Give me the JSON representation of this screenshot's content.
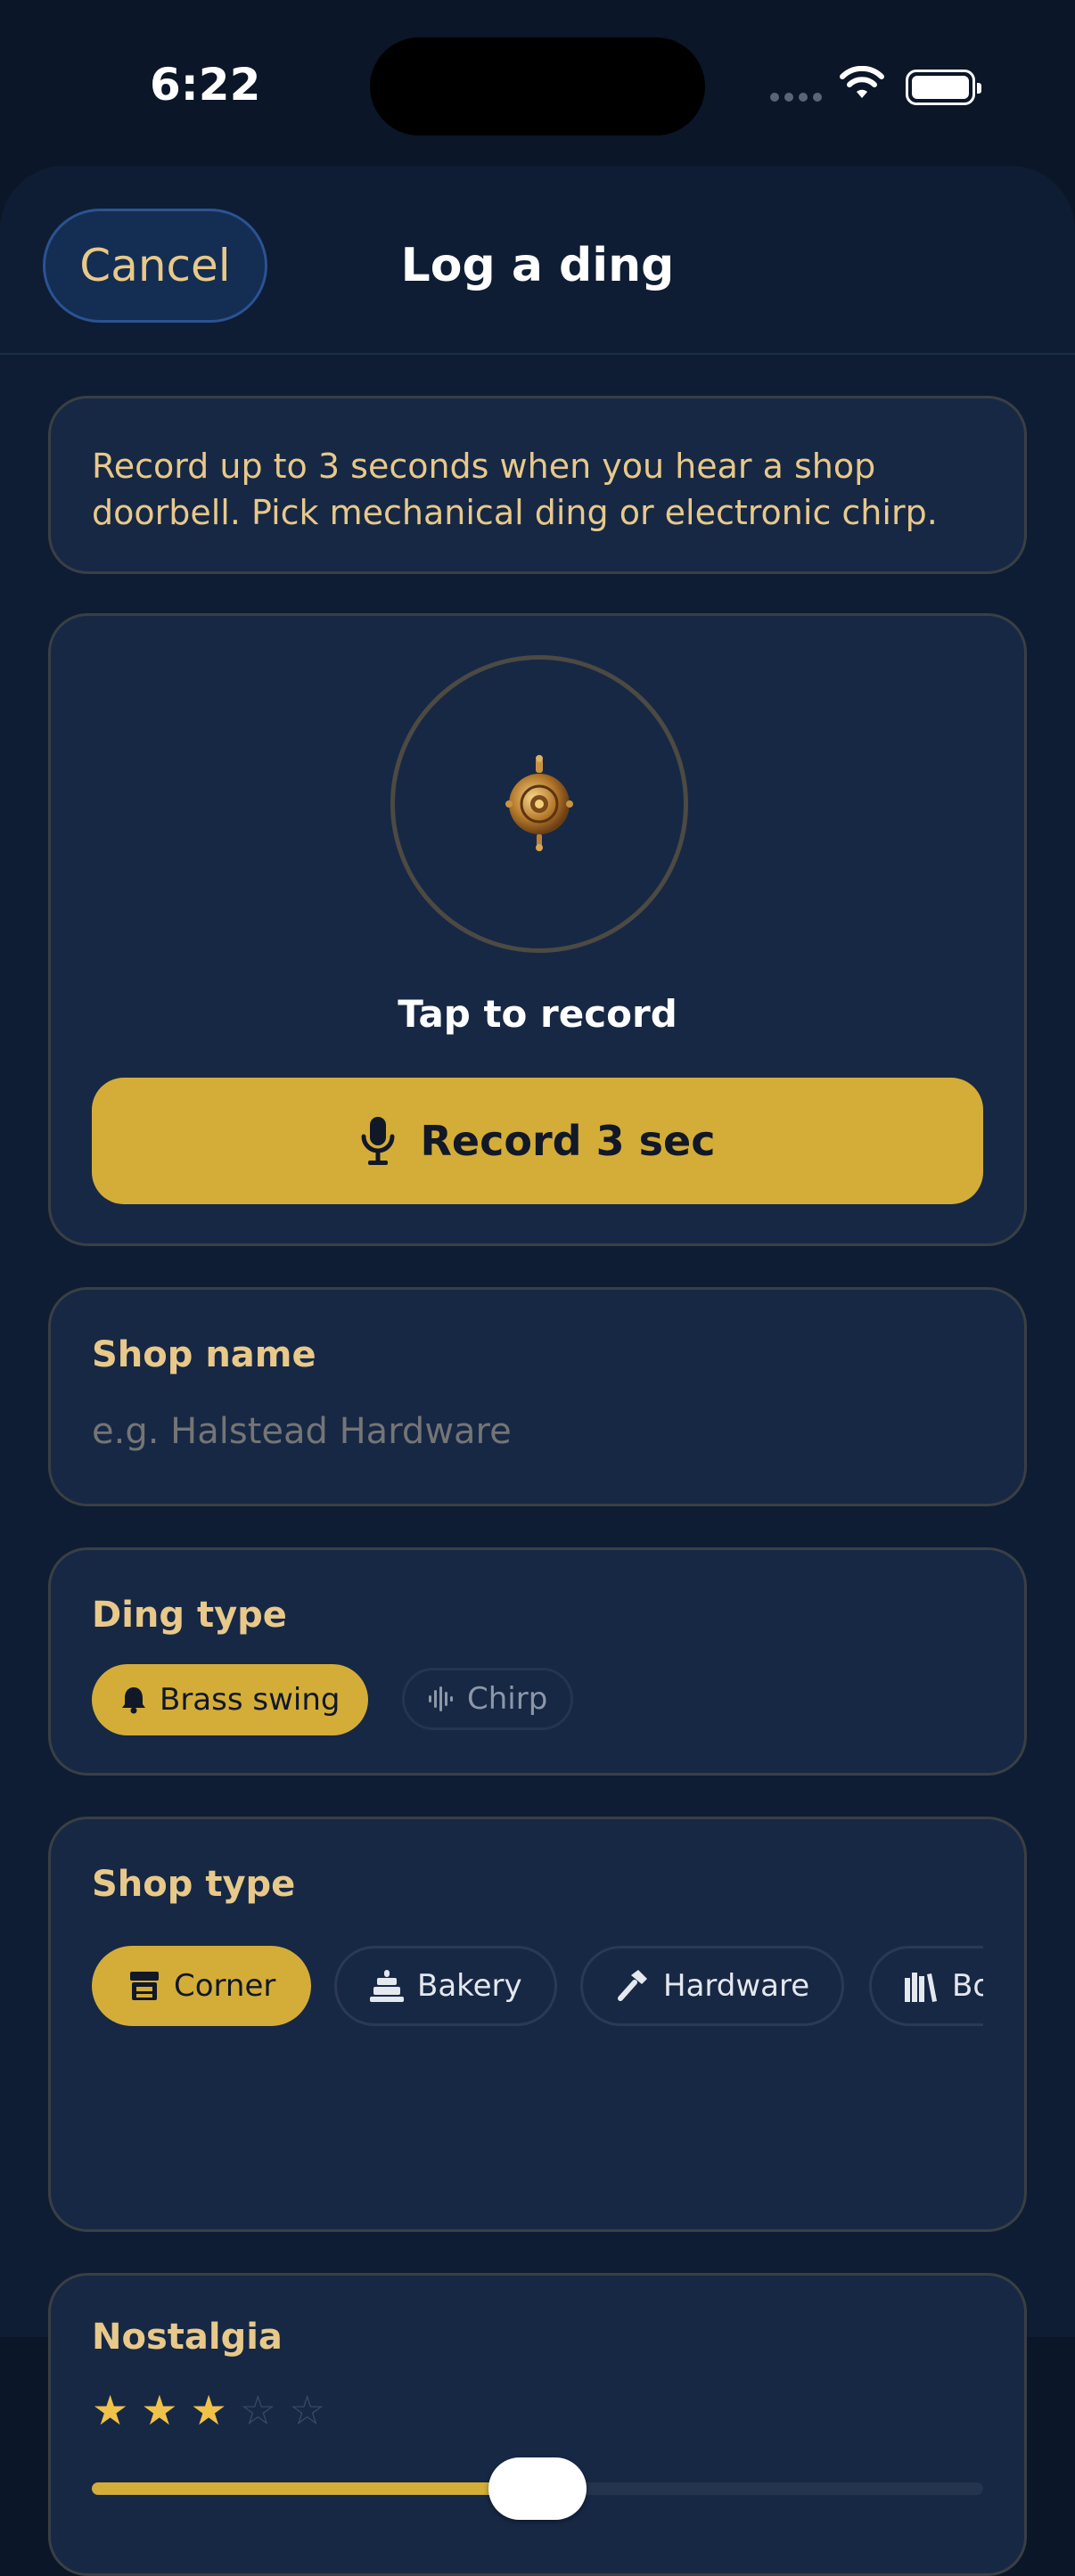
{
  "status_bar": {
    "time": "6:22"
  },
  "header": {
    "cancel_label": "Cancel",
    "title": "Log a ding"
  },
  "info": {
    "text": "Record up to 3 seconds when you hear a shop doorbell. Pick mechanical ding or electronic chirp."
  },
  "recorder": {
    "status_label": "Tap to record",
    "button_label": "Record 3 sec"
  },
  "shop_name": {
    "label": "Shop name",
    "value": "",
    "placeholder": "e.g. Halstead Hardware"
  },
  "ding_type": {
    "label": "Ding type",
    "options": [
      {
        "label": "Brass swing",
        "icon": "bell-icon",
        "selected": true
      },
      {
        "label": "Chirp",
        "icon": "waveform-icon",
        "selected": false
      }
    ]
  },
  "shop_type": {
    "label": "Shop type",
    "options": [
      {
        "label": "Corner",
        "icon": "storefront-icon",
        "selected": true
      },
      {
        "label": "Bakery",
        "icon": "cake-icon",
        "selected": false
      },
      {
        "label": "Hardware",
        "icon": "hammer-icon",
        "selected": false
      },
      {
        "label": "Bo",
        "icon": "books-icon",
        "selected": false
      }
    ]
  },
  "nostalgia": {
    "label": "Nostalgia",
    "rating": 3,
    "max_rating": 5,
    "slider_value": 0.5
  },
  "colors": {
    "accent": "#d4ad38",
    "background": "#0b1628",
    "card": "#172845",
    "label_gold": "#e8c98a"
  }
}
